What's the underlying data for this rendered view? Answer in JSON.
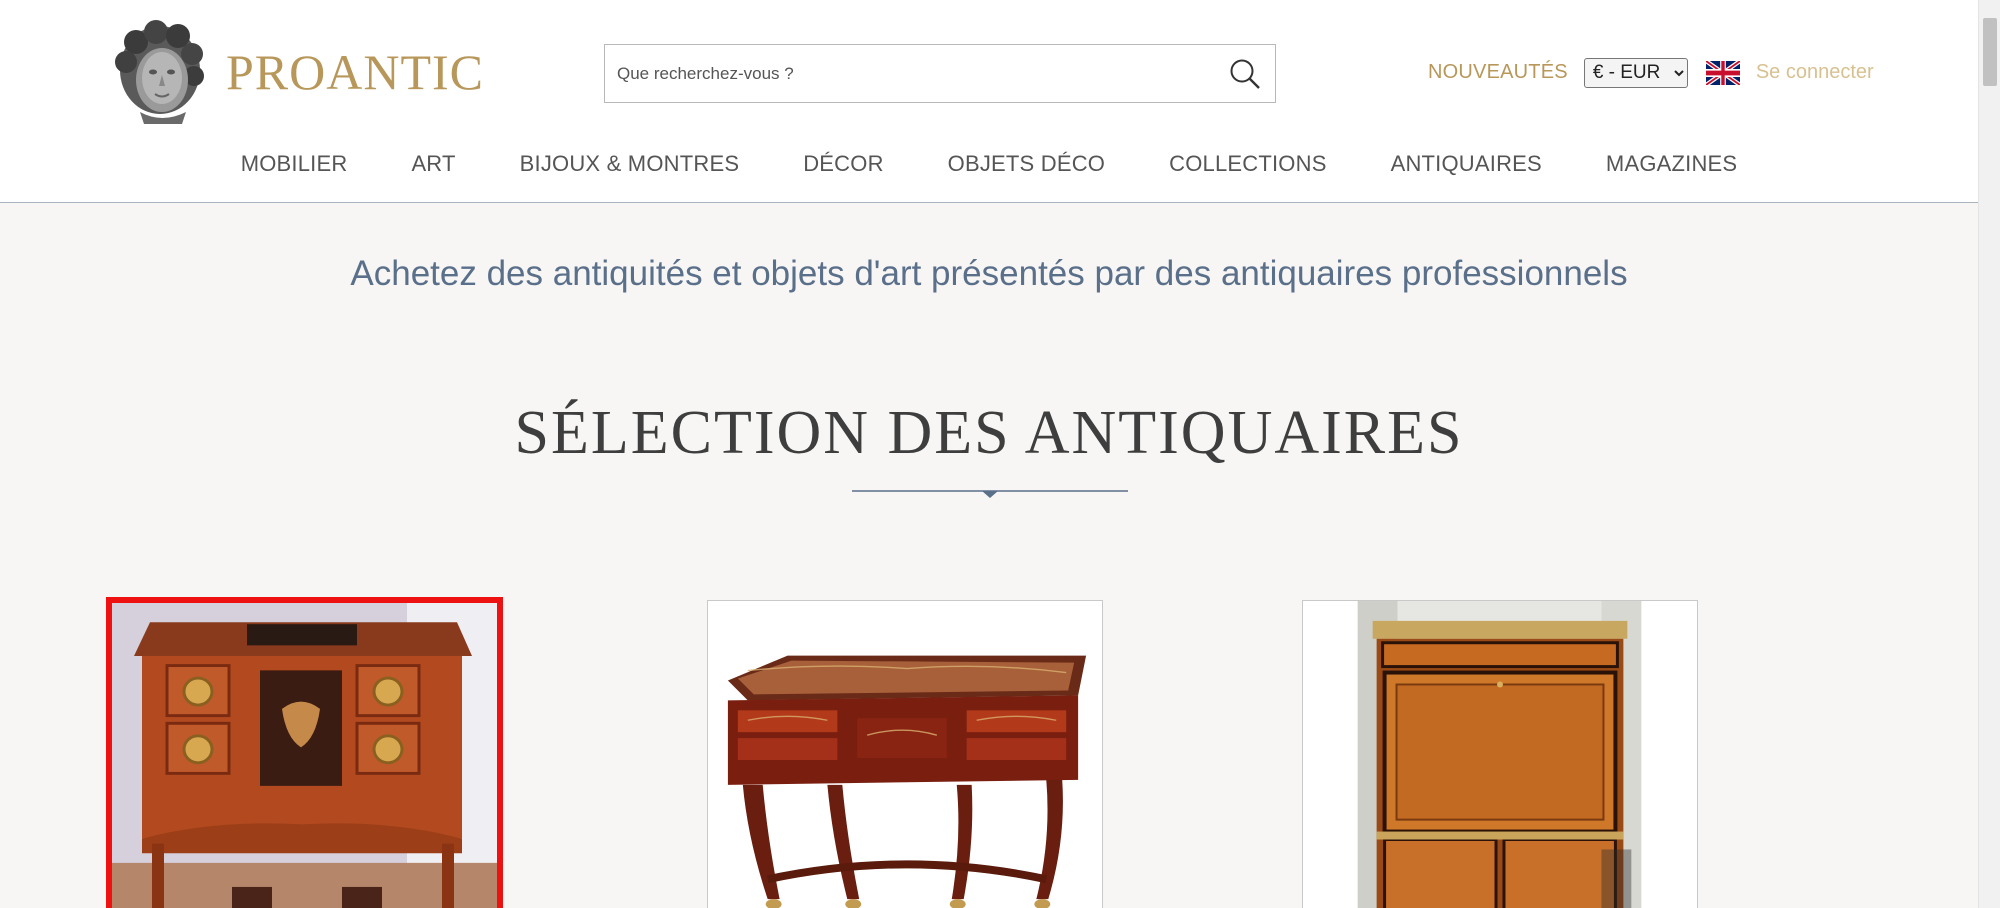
{
  "brand": {
    "name": "PROANTIC",
    "color": "#b8975a"
  },
  "search": {
    "placeholder": "Que recherchez-vous ?"
  },
  "header": {
    "new_label": "NOUVEAUTÉS",
    "currency": {
      "selected": "€ - EUR",
      "options": [
        "€ - EUR"
      ]
    },
    "language_flag": "uk-flag-icon",
    "login_label": "Se connecter"
  },
  "nav": {
    "items": [
      {
        "label": "MOBILIER"
      },
      {
        "label": "ART"
      },
      {
        "label": "BIJOUX & MONTRES"
      },
      {
        "label": "DÉCOR"
      },
      {
        "label": "OBJETS DÉCO"
      },
      {
        "label": "COLLECTIONS"
      },
      {
        "label": "ANTIQUAIRES"
      },
      {
        "label": "MAGAZINES"
      }
    ]
  },
  "main": {
    "tagline": "Achetez des antiquités et objets d'art présentés par des antiquaires professionnels",
    "section_title": "SÉLECTION DES ANTIQUAIRES",
    "cards": [
      {
        "subject": "marquetry-commode-image",
        "selected": true
      },
      {
        "subject": "boulle-desk-image",
        "selected": false
      },
      {
        "subject": "secretaire-cabinet-image",
        "selected": false
      }
    ]
  },
  "colors": {
    "accent_gold": "#b8975a",
    "tagline_blue": "#5a6f8a",
    "selection_red": "#ee1111",
    "page_bg": "#f7f6f4"
  }
}
